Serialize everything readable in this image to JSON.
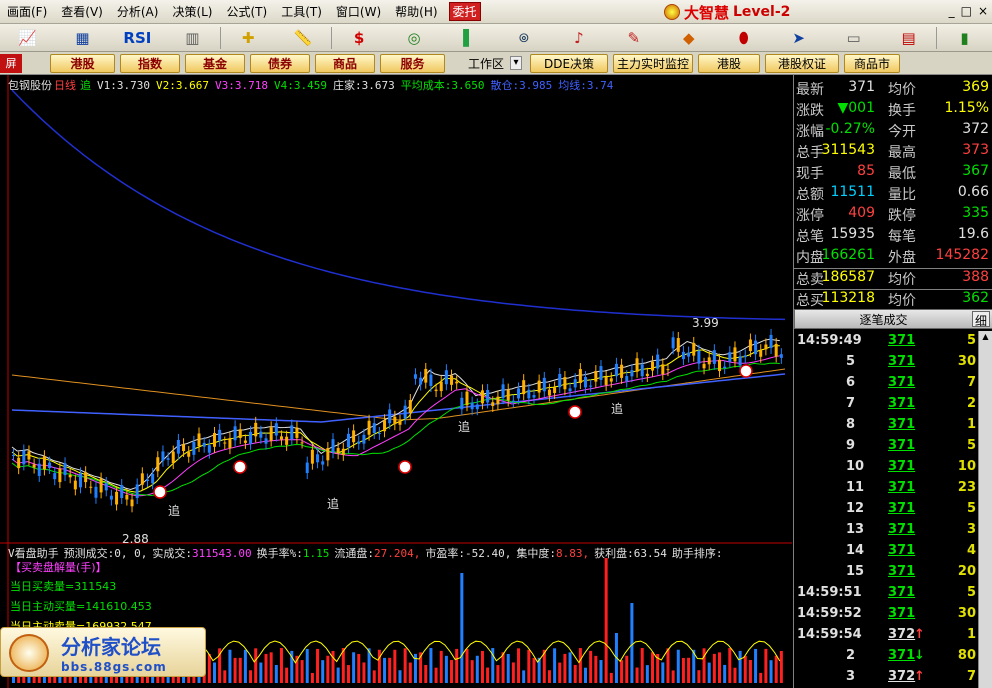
{
  "menu": [
    "画面(F)",
    "查看(V)",
    "分析(A)",
    "决策(L)",
    "公式(T)",
    "工具(T)",
    "窗口(W)",
    "帮助(H)"
  ],
  "menu_special": "委托",
  "brand": {
    "title": "大智慧",
    "level": "Level-2"
  },
  "window_buttons": [
    "_",
    "□",
    "×"
  ],
  "toolbar_items": [
    {
      "icon": "kline-chart-icon",
      "glyph": "📈"
    },
    {
      "icon": "tick-chart-icon",
      "glyph": "▦"
    },
    {
      "icon": "rsi-icon",
      "glyph": "RSI"
    },
    {
      "icon": "indicator-grid-icon",
      "glyph": "▥"
    },
    {
      "icon": "crosshair-icon",
      "glyph": "✚"
    },
    {
      "icon": "ruler-icon",
      "glyph": "📏"
    },
    {
      "icon": "dollar-icon",
      "glyph": "$"
    },
    {
      "icon": "glasses-icon",
      "glyph": "◎"
    },
    {
      "icon": "color-bars-icon",
      "glyph": "▌"
    },
    {
      "icon": "binoculars-icon",
      "glyph": "⌾"
    },
    {
      "icon": "bell-icon",
      "glyph": "♪"
    },
    {
      "icon": "note-icon",
      "glyph": "✎"
    },
    {
      "icon": "diamond-icon",
      "glyph": "◆"
    },
    {
      "icon": "pill-icon",
      "glyph": "⬮"
    },
    {
      "icon": "arrow-icon",
      "glyph": "➤"
    },
    {
      "icon": "monitor-icon",
      "glyph": "▭"
    },
    {
      "icon": "window-icon",
      "glyph": "▤"
    },
    {
      "icon": "books-icon",
      "glyph": "▮"
    }
  ],
  "nav": {
    "left_tab": "屏",
    "buttons": [
      "港股",
      "指数",
      "基金",
      "债券",
      "商品",
      "服务"
    ],
    "workspace": "工作区",
    "buttons2": [
      "DDE决策",
      "主力实时监控",
      "港股",
      "港股权证",
      "商品市"
    ]
  },
  "chart": {
    "stock_name": "包钢股份",
    "period": "日线",
    "chase": "追",
    "ma": [
      {
        "label": "V1:",
        "value": "3.730",
        "color": "#e0e0e0"
      },
      {
        "label": "V2:",
        "value": "3.667",
        "color": "#ffff00"
      },
      {
        "label": "V3:",
        "value": "3.718",
        "color": "#ff40ff"
      },
      {
        "label": "V4:",
        "value": "3.459",
        "color": "#00e000"
      },
      {
        "label": "庄家:",
        "value": "3.673",
        "color": "#e0e0e0"
      },
      {
        "label": "平均成本:",
        "value": "3.650",
        "color": "#00e000"
      },
      {
        "label": "散仓:",
        "value": "3.985",
        "color": "#4060ff"
      },
      {
        "label": "均线:",
        "value": "3.74",
        "color": "#4060ff"
      }
    ],
    "high_label": "3.99",
    "low_label": "2.88",
    "chase_labels": [
      "追",
      "追",
      "追",
      "追"
    ]
  },
  "sub": {
    "legend": [
      {
        "label": "V看盘助手",
        "value": "",
        "color": "#e0e0e0"
      },
      {
        "label": "预测成交:",
        "value": "0, 0,",
        "color": "#e0e0e0"
      },
      {
        "label": "实成交:",
        "value": "311543.00",
        "color": "#ff40ff"
      },
      {
        "label": "换手率%:",
        "value": "1.15",
        "color": "#00e000"
      },
      {
        "label": "流通盘:",
        "value": "27.204,",
        "color": "#ff4040"
      },
      {
        "label": "市盈率:",
        "value": "-52.40,",
        "color": "#e0e0e0"
      },
      {
        "label": "集中度:",
        "value": "8.83,",
        "color": "#ff4040"
      },
      {
        "label": "获利盘:",
        "value": "63.54",
        "color": "#e0e0e0"
      },
      {
        "label": "助手排序:",
        "value": "",
        "color": "#e0e0e0"
      }
    ],
    "line1": "【买卖盘解量(手)】",
    "line2": "当日买卖量=311543",
    "line3": "当日主动买量=141610.453",
    "line4": "当日主动卖量=169932.547"
  },
  "watermark": {
    "title": "分析家论坛",
    "url": "bbs.88gs.com"
  },
  "quote": [
    {
      "k1": "最新",
      "v1": "371",
      "c1": "#e0e0e0",
      "k2": "均价",
      "v2": "369",
      "c2": "#ffff00"
    },
    {
      "k1": "涨跌",
      "v1": "▼001",
      "c1": "#00e000",
      "k2": "换手",
      "v2": "1.15%",
      "c2": "#ffff00"
    },
    {
      "k1": "涨幅",
      "v1": "-0.27%",
      "c1": "#00e000",
      "k2": "今开",
      "v2": "372",
      "c2": "#e0e0e0"
    },
    {
      "k1": "总手",
      "v1": "311543",
      "c1": "#ffff00",
      "k2": "最高",
      "v2": "373",
      "c2": "#ff4040"
    },
    {
      "k1": "现手",
      "v1": "85",
      "c1": "#ff4040",
      "k2": "最低",
      "v2": "367",
      "c2": "#00e000"
    },
    {
      "k1": "总额",
      "v1": "11511",
      "c1": "#00d0ff",
      "k2": "量比",
      "v2": "0.66",
      "c2": "#e0e0e0"
    },
    {
      "k1": "涨停",
      "v1": "409",
      "c1": "#ff4040",
      "k2": "跌停",
      "v2": "335",
      "c2": "#00e000"
    },
    {
      "k1": "总笔",
      "v1": "15935",
      "c1": "#e0e0e0",
      "k2": "每笔",
      "v2": "19.6",
      "c2": "#e0e0e0"
    },
    {
      "k1": "内盘",
      "v1": "166261",
      "c1": "#00e000",
      "k2": "外盘",
      "v2": "145282",
      "c2": "#ff4040"
    },
    {
      "k1": "总卖",
      "v1": "186587",
      "c1": "#ffff00",
      "k2": "均价",
      "v2": "388",
      "c2": "#ff4040"
    },
    {
      "k1": "总买",
      "v1": "113218",
      "c1": "#ffff00",
      "k2": "均价",
      "v2": "362",
      "c2": "#00e000"
    }
  ],
  "ticks_header": "逐笔成交",
  "ticks_btn": "细",
  "ticks": [
    {
      "t": "14:59:49",
      "p": "371",
      "a": "",
      "v": "5"
    },
    {
      "t": "5",
      "p": "371",
      "a": "",
      "v": "30"
    },
    {
      "t": "6",
      "p": "371",
      "a": "",
      "v": "7"
    },
    {
      "t": "7",
      "p": "371",
      "a": "",
      "v": "2"
    },
    {
      "t": "8",
      "p": "371",
      "a": "",
      "v": "1"
    },
    {
      "t": "9",
      "p": "371",
      "a": "",
      "v": "5"
    },
    {
      "t": "10",
      "p": "371",
      "a": "",
      "v": "10"
    },
    {
      "t": "11",
      "p": "371",
      "a": "",
      "v": "23"
    },
    {
      "t": "12",
      "p": "371",
      "a": "",
      "v": "5"
    },
    {
      "t": "13",
      "p": "371",
      "a": "",
      "v": "3"
    },
    {
      "t": "14",
      "p": "371",
      "a": "",
      "v": "4"
    },
    {
      "t": "15",
      "p": "371",
      "a": "",
      "v": "20"
    },
    {
      "t": "14:59:51",
      "p": "371",
      "a": "",
      "v": "5"
    },
    {
      "t": "14:59:52",
      "p": "371",
      "a": "",
      "v": "30"
    },
    {
      "t": "14:59:54",
      "p": "372",
      "a": "↑",
      "v": "1"
    },
    {
      "t": "2",
      "p": "371",
      "a": "↓",
      "v": "80"
    },
    {
      "t": "3",
      "p": "372",
      "a": "↑",
      "v": "7"
    }
  ]
}
